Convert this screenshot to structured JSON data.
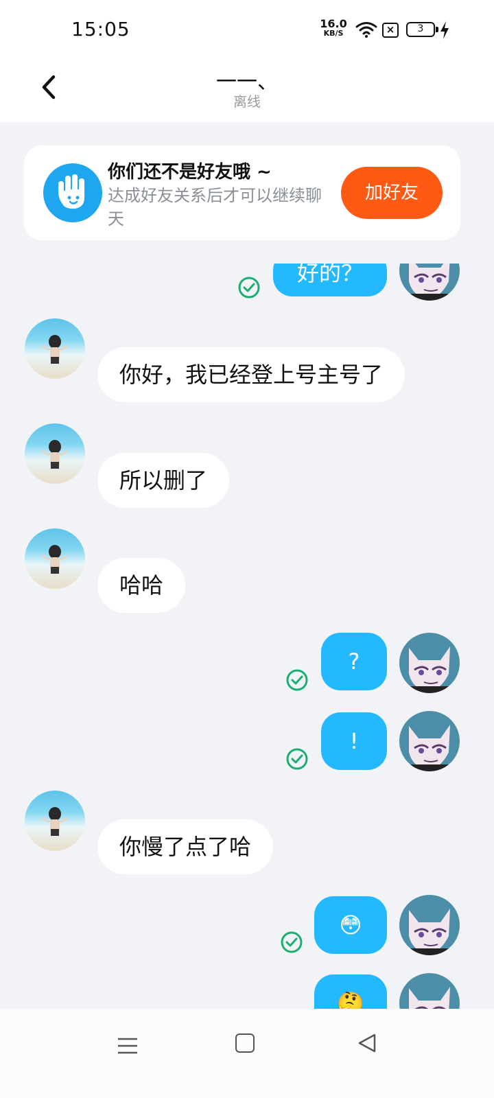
{
  "status_bar": {
    "time": "15:05",
    "net_speed_value": "16.0",
    "net_speed_unit": "KB/S",
    "sim_label": "×",
    "battery_level": "3",
    "icons": [
      "wifi-icon",
      "sim-icon",
      "battery-icon",
      "charging-icon"
    ]
  },
  "header": {
    "title": "一一、",
    "status": "离线",
    "back_icon": "chevron-left-icon"
  },
  "friend_banner": {
    "title": "你们还不是好友哦 ~",
    "description": "达成好友关系后才可以继续聊天",
    "button_label": "加好友",
    "icon": "hand-wave-icon",
    "button_color": "#ff5a14",
    "icon_color": "#1ea7f0"
  },
  "messages": [
    {
      "from": "self",
      "text": "好的？",
      "read": true
    },
    {
      "from": "other",
      "text": "你好，我已经登上号主号了"
    },
    {
      "from": "other",
      "text": "所以删了"
    },
    {
      "from": "other",
      "text": "哈哈"
    },
    {
      "from": "self",
      "text": "?",
      "read": true
    },
    {
      "from": "self",
      "text": "!",
      "read": true
    },
    {
      "from": "other",
      "text": "你慢了点了哈"
    },
    {
      "from": "self",
      "text": "😳",
      "read": true
    },
    {
      "from": "self",
      "text": "🤔",
      "read": false
    }
  ],
  "colors": {
    "outgoing_bubble": "#24b8ff",
    "incoming_bubble": "#ffffff",
    "read_check": "#1aae6f",
    "chat_background": "#f1f3f7"
  },
  "nav_bar": {
    "icons": [
      "menu-icon",
      "home-icon",
      "back-triangle-icon"
    ]
  }
}
